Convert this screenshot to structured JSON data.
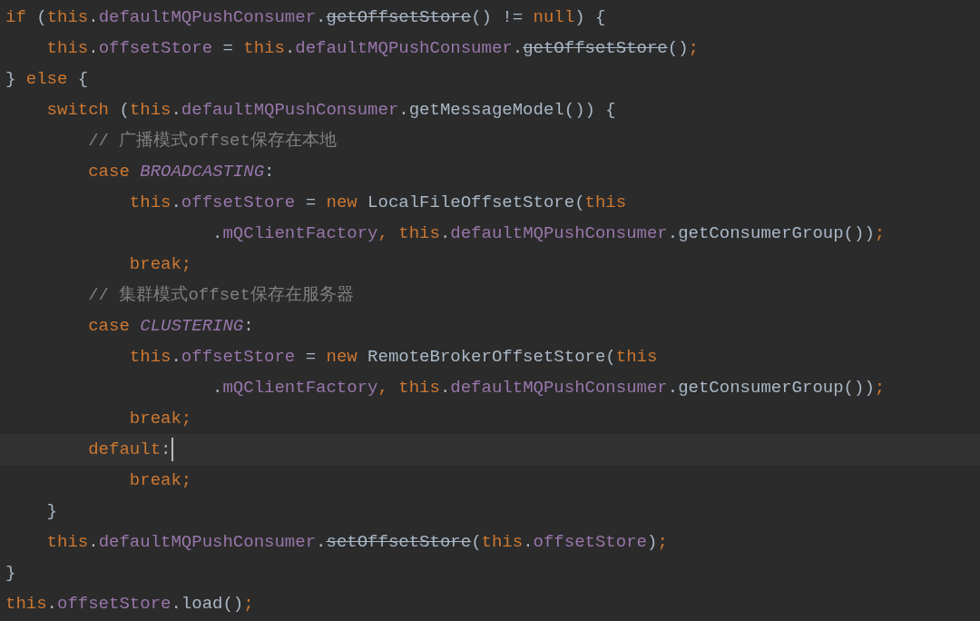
{
  "editor": {
    "lines": [
      {
        "current": false,
        "tokens": [
          {
            "kind": "keyword",
            "text": "if "
          },
          {
            "kind": "plain",
            "text": "("
          },
          {
            "kind": "keyword",
            "text": "this"
          },
          {
            "kind": "plain",
            "text": "."
          },
          {
            "kind": "field",
            "text": "defaultMQPushConsumer"
          },
          {
            "kind": "plain",
            "text": "."
          },
          {
            "kind": "deprecated",
            "text": "getOffsetStore"
          },
          {
            "kind": "plain",
            "text": "() != "
          },
          {
            "kind": "keyword",
            "text": "null"
          },
          {
            "kind": "plain",
            "text": ") {"
          }
        ]
      },
      {
        "current": false,
        "tokens": [
          {
            "kind": "keyword",
            "text": "    this"
          },
          {
            "kind": "plain",
            "text": "."
          },
          {
            "kind": "field",
            "text": "offsetStore"
          },
          {
            "kind": "plain",
            "text": " = "
          },
          {
            "kind": "keyword",
            "text": "this"
          },
          {
            "kind": "plain",
            "text": "."
          },
          {
            "kind": "field",
            "text": "defaultMQPushConsumer"
          },
          {
            "kind": "plain",
            "text": "."
          },
          {
            "kind": "deprecated",
            "text": "getOffsetStore"
          },
          {
            "kind": "plain",
            "text": "()"
          },
          {
            "kind": "keyword",
            "text": ";"
          }
        ]
      },
      {
        "current": false,
        "tokens": [
          {
            "kind": "plain",
            "text": "} "
          },
          {
            "kind": "keyword",
            "text": "else "
          },
          {
            "kind": "plain",
            "text": "{"
          }
        ]
      },
      {
        "current": false,
        "tokens": [
          {
            "kind": "keyword",
            "text": "    switch "
          },
          {
            "kind": "plain",
            "text": "("
          },
          {
            "kind": "keyword",
            "text": "this"
          },
          {
            "kind": "plain",
            "text": "."
          },
          {
            "kind": "field",
            "text": "defaultMQPushConsumer"
          },
          {
            "kind": "plain",
            "text": ".getMessageModel()) {"
          }
        ]
      },
      {
        "current": false,
        "tokens": [
          {
            "kind": "comment",
            "text": "        // 广播模式offset保存在本地"
          }
        ]
      },
      {
        "current": false,
        "tokens": [
          {
            "kind": "keyword",
            "text": "        case "
          },
          {
            "kind": "constant",
            "text": "BROADCASTING"
          },
          {
            "kind": "plain",
            "text": ":"
          }
        ]
      },
      {
        "current": false,
        "tokens": [
          {
            "kind": "keyword",
            "text": "            this"
          },
          {
            "kind": "plain",
            "text": "."
          },
          {
            "kind": "field",
            "text": "offsetStore"
          },
          {
            "kind": "plain",
            "text": " = "
          },
          {
            "kind": "keyword",
            "text": "new "
          },
          {
            "kind": "plain",
            "text": "LocalFileOffsetStore("
          },
          {
            "kind": "keyword",
            "text": "this"
          }
        ]
      },
      {
        "current": false,
        "tokens": [
          {
            "kind": "plain",
            "text": "                    ."
          },
          {
            "kind": "field",
            "text": "mQClientFactory"
          },
          {
            "kind": "keyword",
            "text": ", this"
          },
          {
            "kind": "plain",
            "text": "."
          },
          {
            "kind": "field",
            "text": "defaultMQPushConsumer"
          },
          {
            "kind": "plain",
            "text": ".getConsumerGroup())"
          },
          {
            "kind": "keyword",
            "text": ";"
          }
        ]
      },
      {
        "current": false,
        "tokens": [
          {
            "kind": "keyword",
            "text": "            break;"
          }
        ]
      },
      {
        "current": false,
        "tokens": [
          {
            "kind": "comment",
            "text": "        // 集群模式offset保存在服务器"
          }
        ]
      },
      {
        "current": false,
        "tokens": [
          {
            "kind": "keyword",
            "text": "        case "
          },
          {
            "kind": "constant",
            "text": "CLUSTERING"
          },
          {
            "kind": "plain",
            "text": ":"
          }
        ]
      },
      {
        "current": false,
        "tokens": [
          {
            "kind": "keyword",
            "text": "            this"
          },
          {
            "kind": "plain",
            "text": "."
          },
          {
            "kind": "field",
            "text": "offsetStore"
          },
          {
            "kind": "plain",
            "text": " = "
          },
          {
            "kind": "keyword",
            "text": "new "
          },
          {
            "kind": "plain",
            "text": "RemoteBrokerOffsetStore("
          },
          {
            "kind": "keyword",
            "text": "this"
          }
        ]
      },
      {
        "current": false,
        "tokens": [
          {
            "kind": "plain",
            "text": "                    ."
          },
          {
            "kind": "field",
            "text": "mQClientFactory"
          },
          {
            "kind": "keyword",
            "text": ", this"
          },
          {
            "kind": "plain",
            "text": "."
          },
          {
            "kind": "field",
            "text": "defaultMQPushConsumer"
          },
          {
            "kind": "plain",
            "text": ".getConsumerGroup())"
          },
          {
            "kind": "keyword",
            "text": ";"
          }
        ]
      },
      {
        "current": false,
        "tokens": [
          {
            "kind": "keyword",
            "text": "            break;"
          }
        ]
      },
      {
        "current": true,
        "tokens": [
          {
            "kind": "keyword",
            "text": "        default"
          },
          {
            "kind": "plain",
            "text": ":"
          }
        ]
      },
      {
        "current": false,
        "tokens": [
          {
            "kind": "keyword",
            "text": "            break;"
          }
        ]
      },
      {
        "current": false,
        "tokens": [
          {
            "kind": "plain",
            "text": "    }"
          }
        ]
      },
      {
        "current": false,
        "tokens": [
          {
            "kind": "keyword",
            "text": "    this"
          },
          {
            "kind": "plain",
            "text": "."
          },
          {
            "kind": "field",
            "text": "defaultMQPushConsumer"
          },
          {
            "kind": "plain",
            "text": "."
          },
          {
            "kind": "deprecated",
            "text": "setOffsetStore"
          },
          {
            "kind": "plain",
            "text": "("
          },
          {
            "kind": "keyword",
            "text": "this"
          },
          {
            "kind": "plain",
            "text": "."
          },
          {
            "kind": "field",
            "text": "offsetStore"
          },
          {
            "kind": "plain",
            "text": ")"
          },
          {
            "kind": "keyword",
            "text": ";"
          }
        ]
      },
      {
        "current": false,
        "tokens": [
          {
            "kind": "plain",
            "text": "}"
          }
        ]
      },
      {
        "current": false,
        "tokens": [
          {
            "kind": "keyword",
            "text": "this"
          },
          {
            "kind": "plain",
            "text": "."
          },
          {
            "kind": "field",
            "text": "offsetStore"
          },
          {
            "kind": "plain",
            "text": ".load()"
          },
          {
            "kind": "keyword",
            "text": ";"
          }
        ]
      }
    ]
  }
}
